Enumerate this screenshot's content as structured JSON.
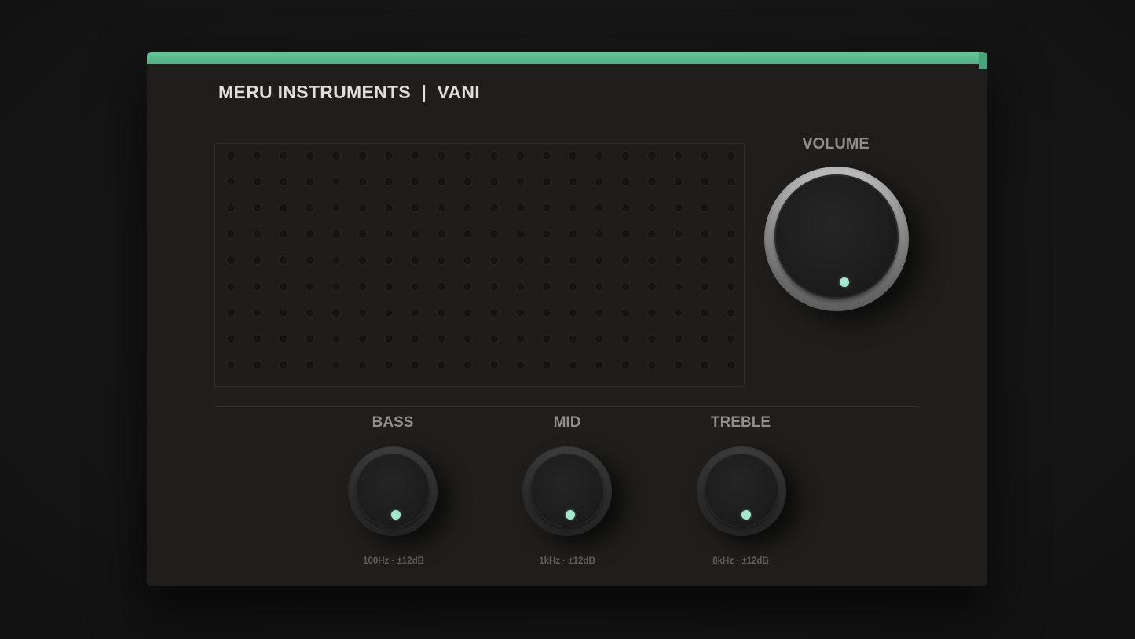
{
  "device": {
    "brand": "MERU INSTRUMENTS  |  VANI",
    "accent_color": "#5fc195",
    "indicator_color": "#a3e8cd"
  },
  "volume": {
    "label": "VOLUME"
  },
  "eq": {
    "bass": {
      "label": "BASS",
      "spec": "100Hz · ±12dB"
    },
    "mid": {
      "label": "MID",
      "spec": "1kHz · ±12dB"
    },
    "treble": {
      "label": "TREBLE",
      "spec": "8kHz · ±12dB"
    }
  }
}
